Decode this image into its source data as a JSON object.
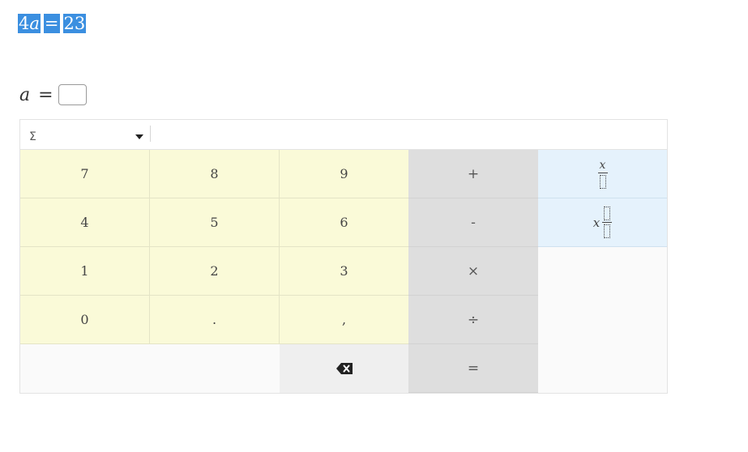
{
  "equation": {
    "coefficient": "4",
    "variable": "a",
    "equals": "=",
    "rhs": "23"
  },
  "answer": {
    "variable": "a",
    "equals": "=",
    "value": ""
  },
  "keypad": {
    "category": "Σ",
    "digits": {
      "k7": "7",
      "k8": "8",
      "k9": "9",
      "k4": "4",
      "k5": "5",
      "k6": "6",
      "k1": "1",
      "k2": "2",
      "k3": "3",
      "k0": "0",
      "dot": ".",
      "comma": ","
    },
    "ops": {
      "plus": "+",
      "minus": "-",
      "times": "×",
      "divide": "÷",
      "equals": "="
    },
    "fraction": {
      "variable": "x"
    },
    "mixed_fraction": {
      "variable": "x"
    },
    "icons": {
      "backspace": "backspace-icon",
      "category_caret": "caret-down-icon"
    },
    "colors": {
      "selection": "#3b8fe0",
      "number_keys": "#fafad8",
      "operator_keys": "#dedede",
      "template_keys": "#e5f2fc"
    }
  }
}
